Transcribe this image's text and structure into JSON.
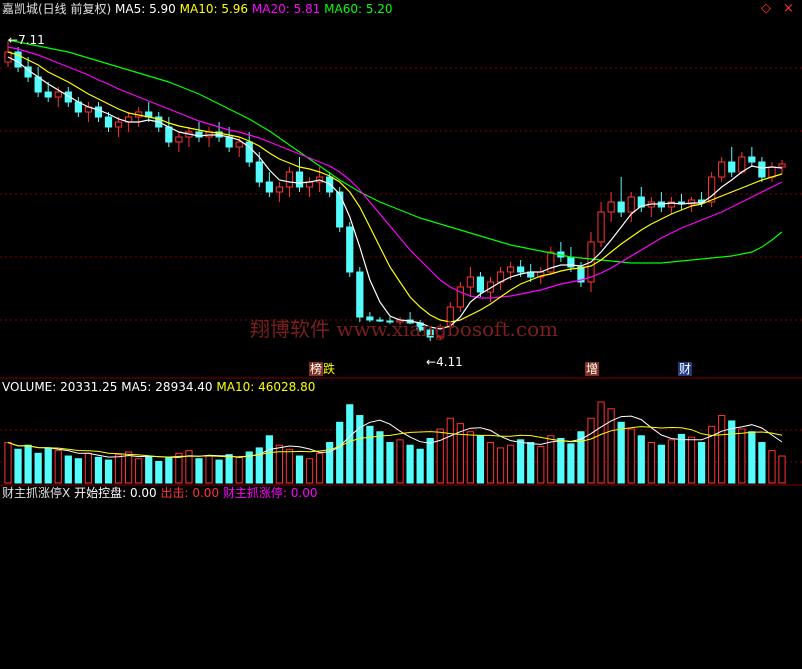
{
  "header": {
    "stock_name": "嘉凯城(日线 前复权)",
    "ma5": {
      "label": "MA5:",
      "value": "5.90",
      "color": "#ffffff"
    },
    "ma10": {
      "label": "MA10:",
      "value": "5.96",
      "color": "#ffff00"
    },
    "ma20": {
      "label": "MA20:",
      "value": "5.81",
      "color": "#ff00ff"
    },
    "ma60": {
      "label": "MA60:",
      "value": "5.20",
      "color": "#00ff00"
    }
  },
  "price_panel": {
    "high_label": "7.11",
    "low_label": "4.11",
    "watermark": "翔博软件 www.xiangbosoft.com",
    "events": [
      "榜",
      "跌",
      "增",
      "财"
    ],
    "nav_icons": [
      "◇",
      "×"
    ]
  },
  "volume_panel": {
    "title": "VOLUME:",
    "volume": "20331.25",
    "ma5_label": "MA5:",
    "ma5": "28934.40",
    "ma10_label": "MA10:",
    "ma10": "46028.80"
  },
  "indicator_panel": {
    "title": "财主抓涨停X",
    "start_label": "开始控盘:",
    "start_value": "0.00",
    "out_label": "出击:",
    "out_value": "0.00",
    "limit_label": "财主抓涨停:",
    "limit_value": "0.00"
  },
  "colors": {
    "up": "#ff3232",
    "down": "#54fcfc",
    "ma5": "#ffffff",
    "ma10": "#ffff00",
    "ma20": "#ff00ff",
    "ma60": "#00ff00",
    "grid": "#800000",
    "signal_line": "#ff0000",
    "signal_bar": "#a0a000"
  },
  "chart_data": {
    "type": "candlestick",
    "ylim": [
      4.0,
      7.3
    ],
    "candles": [
      [
        6.9,
        7.11,
        6.85,
        7.0
      ],
      [
        7.0,
        7.05,
        6.8,
        6.85
      ],
      [
        6.85,
        6.95,
        6.7,
        6.75
      ],
      [
        6.75,
        6.85,
        6.55,
        6.6
      ],
      [
        6.6,
        6.7,
        6.5,
        6.55
      ],
      [
        6.55,
        6.65,
        6.45,
        6.6
      ],
      [
        6.6,
        6.65,
        6.45,
        6.5
      ],
      [
        6.5,
        6.55,
        6.35,
        6.4
      ],
      [
        6.4,
        6.5,
        6.3,
        6.45
      ],
      [
        6.45,
        6.5,
        6.3,
        6.35
      ],
      [
        6.35,
        6.4,
        6.2,
        6.25
      ],
      [
        6.25,
        6.35,
        6.15,
        6.3
      ],
      [
        6.3,
        6.4,
        6.2,
        6.35
      ],
      [
        6.35,
        6.45,
        6.25,
        6.4
      ],
      [
        6.4,
        6.5,
        6.3,
        6.35
      ],
      [
        6.35,
        6.4,
        6.2,
        6.25
      ],
      [
        6.25,
        6.35,
        6.05,
        6.1
      ],
      [
        6.1,
        6.2,
        6.0,
        6.15
      ],
      [
        6.15,
        6.25,
        6.05,
        6.2
      ],
      [
        6.2,
        6.3,
        6.1,
        6.15
      ],
      [
        6.15,
        6.25,
        6.05,
        6.2
      ],
      [
        6.2,
        6.3,
        6.1,
        6.15
      ],
      [
        6.15,
        6.25,
        6.0,
        6.05
      ],
      [
        6.05,
        6.15,
        5.95,
        6.1
      ],
      [
        6.1,
        6.2,
        5.85,
        5.9
      ],
      [
        5.9,
        6.0,
        5.65,
        5.7
      ],
      [
        5.7,
        5.8,
        5.55,
        5.6
      ],
      [
        5.6,
        5.7,
        5.5,
        5.65
      ],
      [
        5.65,
        5.85,
        5.55,
        5.8
      ],
      [
        5.8,
        5.95,
        5.6,
        5.65
      ],
      [
        5.65,
        5.75,
        5.55,
        5.7
      ],
      [
        5.7,
        5.85,
        5.6,
        5.75
      ],
      [
        5.75,
        5.8,
        5.55,
        5.6
      ],
      [
        5.6,
        5.65,
        5.2,
        5.25
      ],
      [
        5.25,
        5.3,
        4.75,
        4.8
      ],
      [
        4.8,
        4.85,
        4.3,
        4.35
      ],
      [
        4.35,
        4.4,
        4.3,
        4.32
      ],
      [
        4.32,
        4.35,
        4.3,
        4.31
      ],
      [
        4.31,
        4.35,
        4.28,
        4.3
      ],
      [
        4.3,
        4.35,
        4.27,
        4.32
      ],
      [
        4.32,
        4.4,
        4.28,
        4.29
      ],
      [
        4.29,
        4.32,
        4.2,
        4.22
      ],
      [
        4.22,
        4.25,
        4.11,
        4.15
      ],
      [
        4.15,
        4.28,
        4.12,
        4.25
      ],
      [
        4.25,
        4.5,
        4.22,
        4.45
      ],
      [
        4.45,
        4.7,
        4.4,
        4.65
      ],
      [
        4.65,
        4.85,
        4.55,
        4.75
      ],
      [
        4.75,
        4.8,
        4.55,
        4.6
      ],
      [
        4.6,
        4.75,
        4.5,
        4.7
      ],
      [
        4.7,
        4.85,
        4.62,
        4.8
      ],
      [
        4.8,
        4.9,
        4.72,
        4.85
      ],
      [
        4.85,
        4.92,
        4.75,
        4.8
      ],
      [
        4.8,
        4.88,
        4.7,
        4.75
      ],
      [
        4.75,
        4.85,
        4.68,
        4.8
      ],
      [
        4.8,
        5.05,
        4.78,
        5.0
      ],
      [
        5.0,
        5.1,
        4.9,
        4.95
      ],
      [
        4.95,
        5.05,
        4.8,
        4.85
      ],
      [
        4.85,
        4.9,
        4.65,
        4.7
      ],
      [
        4.7,
        5.2,
        4.6,
        5.1
      ],
      [
        5.1,
        5.5,
        5.05,
        5.4
      ],
      [
        5.4,
        5.6,
        5.3,
        5.5
      ],
      [
        5.5,
        5.75,
        5.35,
        5.4
      ],
      [
        5.4,
        5.6,
        5.3,
        5.55
      ],
      [
        5.55,
        5.65,
        5.4,
        5.45
      ],
      [
        5.45,
        5.55,
        5.35,
        5.5
      ],
      [
        5.5,
        5.6,
        5.4,
        5.45
      ],
      [
        5.45,
        5.55,
        5.38,
        5.5
      ],
      [
        5.5,
        5.58,
        5.42,
        5.48
      ],
      [
        5.48,
        5.55,
        5.4,
        5.52
      ],
      [
        5.52,
        5.6,
        5.45,
        5.5
      ],
      [
        5.5,
        5.8,
        5.45,
        5.75
      ],
      [
        5.75,
        5.95,
        5.7,
        5.9
      ],
      [
        5.9,
        6.05,
        5.75,
        5.8
      ],
      [
        5.8,
        6.0,
        5.78,
        5.95
      ],
      [
        5.95,
        6.05,
        5.85,
        5.9
      ],
      [
        5.9,
        5.95,
        5.7,
        5.75
      ],
      [
        5.75,
        5.9,
        5.7,
        5.85
      ],
      [
        5.85,
        5.92,
        5.78,
        5.88
      ]
    ],
    "ma5": [
      6.95,
      6.9,
      6.82,
      6.75,
      6.68,
      6.62,
      6.56,
      6.5,
      6.45,
      6.42,
      6.38,
      6.33,
      6.3,
      6.3,
      6.32,
      6.3,
      6.25,
      6.2,
      6.18,
      6.16,
      6.17,
      6.17,
      6.15,
      6.12,
      6.05,
      5.95,
      5.82,
      5.72,
      5.7,
      5.69,
      5.7,
      5.72,
      5.68,
      5.58,
      5.35,
      5.05,
      4.72,
      4.5,
      4.36,
      4.32,
      4.31,
      4.29,
      4.25,
      4.23,
      4.26,
      4.35,
      4.5,
      4.58,
      4.64,
      4.7,
      4.75,
      4.78,
      4.8,
      4.8,
      4.84,
      4.87,
      4.87,
      4.86,
      4.9,
      5.0,
      5.12,
      5.25,
      5.38,
      5.46,
      5.48,
      5.48,
      5.49,
      5.48,
      5.49,
      5.49,
      5.56,
      5.65,
      5.72,
      5.8,
      5.86,
      5.84,
      5.85,
      5.84
    ],
    "ma10": [
      7.0,
      6.97,
      6.92,
      6.87,
      6.8,
      6.75,
      6.7,
      6.64,
      6.58,
      6.53,
      6.48,
      6.43,
      6.39,
      6.37,
      6.35,
      6.33,
      6.29,
      6.26,
      6.24,
      6.22,
      6.2,
      6.19,
      6.17,
      6.15,
      6.11,
      6.06,
      5.99,
      5.93,
      5.89,
      5.85,
      5.83,
      5.8,
      5.76,
      5.7,
      5.6,
      5.45,
      5.25,
      5.05,
      4.85,
      4.7,
      4.55,
      4.45,
      4.37,
      4.32,
      4.3,
      4.32,
      4.37,
      4.42,
      4.48,
      4.55,
      4.62,
      4.68,
      4.72,
      4.76,
      4.78,
      4.81,
      4.83,
      4.84,
      4.86,
      4.92,
      5.0,
      5.08,
      5.15,
      5.22,
      5.28,
      5.33,
      5.38,
      5.42,
      5.46,
      5.48,
      5.52,
      5.56,
      5.6,
      5.64,
      5.68,
      5.72,
      5.75,
      5.78
    ],
    "ma20": [
      7.05,
      7.03,
      7.0,
      6.97,
      6.93,
      6.89,
      6.85,
      6.81,
      6.77,
      6.72,
      6.68,
      6.63,
      6.59,
      6.55,
      6.51,
      6.47,
      6.43,
      6.39,
      6.35,
      6.31,
      6.28,
      6.25,
      6.22,
      6.2,
      6.17,
      6.14,
      6.1,
      6.06,
      6.02,
      5.98,
      5.94,
      5.9,
      5.86,
      5.8,
      5.72,
      5.62,
      5.5,
      5.38,
      5.26,
      5.14,
      5.02,
      4.92,
      4.82,
      4.72,
      4.65,
      4.6,
      4.56,
      4.54,
      4.54,
      4.55,
      4.56,
      4.58,
      4.6,
      4.62,
      4.65,
      4.68,
      4.7,
      4.72,
      4.75,
      4.79,
      4.84,
      4.9,
      4.96,
      5.02,
      5.08,
      5.14,
      5.19,
      5.24,
      5.28,
      5.32,
      5.36,
      5.4,
      5.45,
      5.5,
      5.55,
      5.6,
      5.65,
      5.7
    ],
    "ma60": [
      7.12,
      7.1,
      7.08,
      7.06,
      7.04,
      7.02,
      7.0,
      6.97,
      6.94,
      6.91,
      6.88,
      6.85,
      6.82,
      6.79,
      6.76,
      6.73,
      6.7,
      6.66,
      6.62,
      6.58,
      6.53,
      6.48,
      6.43,
      6.38,
      6.33,
      6.27,
      6.21,
      6.14,
      6.07,
      6.0,
      5.93,
      5.86,
      5.79,
      5.72,
      5.66,
      5.6,
      5.55,
      5.5,
      5.46,
      5.42,
      5.38,
      5.34,
      5.31,
      5.28,
      5.25,
      5.22,
      5.19,
      5.16,
      5.13,
      5.1,
      5.07,
      5.05,
      5.03,
      5.01,
      4.99,
      4.97,
      4.95,
      4.94,
      4.93,
      4.92,
      4.91,
      4.9,
      4.89,
      4.89,
      4.89,
      4.89,
      4.9,
      4.91,
      4.92,
      4.93,
      4.94,
      4.95,
      4.96,
      4.98,
      5.0,
      5.05,
      5.12,
      5.2
    ],
    "volume": [
      30,
      25,
      28,
      22,
      26,
      24,
      20,
      18,
      22,
      19,
      17,
      21,
      23,
      18,
      20,
      16,
      19,
      22,
      24,
      18,
      20,
      17,
      21,
      19,
      23,
      26,
      35,
      28,
      25,
      20,
      18,
      22,
      30,
      45,
      58,
      50,
      42,
      38,
      30,
      32,
      28,
      25,
      33,
      40,
      48,
      44,
      38,
      35,
      30,
      26,
      28,
      32,
      30,
      27,
      35,
      33,
      29,
      38,
      48,
      60,
      55,
      45,
      40,
      35,
      30,
      28,
      32,
      36,
      34,
      30,
      42,
      50,
      46,
      40,
      38,
      30,
      24,
      20
    ],
    "signal_bars": [],
    "signal_peaks": [],
    "signal_bar_range": [],
    "marks_x": []
  }
}
